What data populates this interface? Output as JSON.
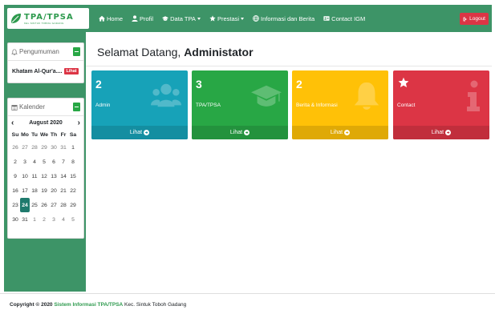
{
  "brand": {
    "name": "TPA/TPSA",
    "subtitle": "KEL.SINTUK TOBOH GADANG"
  },
  "nav": {
    "items": [
      {
        "label": "Home",
        "icon": "home-icon"
      },
      {
        "label": "Profil",
        "icon": "user-icon"
      },
      {
        "label": "Data TPA",
        "icon": "graduation-cap-icon",
        "dropdown": true
      },
      {
        "label": "Prestasi",
        "icon": "star-icon",
        "dropdown": true
      },
      {
        "label": "Informasi dan Berita",
        "icon": "globe-icon"
      },
      {
        "label": "Contact IGM",
        "icon": "address-card-icon"
      }
    ],
    "logout_label": "Logout"
  },
  "sidebar": {
    "announcement": {
      "title": "Pengumuman",
      "item_text": "Khatam Al-Qur'a....",
      "item_badge": "Lihat"
    },
    "calendar": {
      "title": "Kalender",
      "prev": "‹",
      "next": "›",
      "month_label": "August 2020",
      "weekdays": [
        "Su",
        "Mo",
        "Tu",
        "We",
        "Th",
        "Fr",
        "Sa"
      ],
      "weeks": [
        [
          "26",
          "27",
          "28",
          "29",
          "30",
          "31",
          "1"
        ],
        [
          "2",
          "3",
          "4",
          "5",
          "6",
          "7",
          "8"
        ],
        [
          "9",
          "10",
          "11",
          "12",
          "13",
          "14",
          "15"
        ],
        [
          "16",
          "17",
          "18",
          "19",
          "20",
          "21",
          "22"
        ],
        [
          "23",
          "24",
          "25",
          "26",
          "27",
          "28",
          "29"
        ],
        [
          "30",
          "31",
          "1",
          "2",
          "3",
          "4",
          "5"
        ]
      ],
      "today": "24"
    }
  },
  "main": {
    "greeting": "Selamat Datang,",
    "username": "Administator",
    "boxes": [
      {
        "count": "2",
        "label": "Admin",
        "footer": "Lihat",
        "icon": "users-icon",
        "color": "#17a2b8",
        "footer_color": "#148ea1"
      },
      {
        "count": "3",
        "label": "TPA/TPSA",
        "footer": "Lihat",
        "icon": "graduation-cap-icon",
        "color": "#28a745",
        "footer_color": "#23923d"
      },
      {
        "count": "2",
        "label": "Berita & Informasi",
        "footer": "Lihat",
        "icon": "bell-icon",
        "color": "#ffc107",
        "footer_color": "#dfa906"
      },
      {
        "count": "",
        "label": "Contact",
        "footer": "Lihat",
        "icon": "info-icon",
        "top_icon": "star-icon",
        "color": "#dc3545",
        "footer_color": "#c12e3c"
      }
    ]
  },
  "footer": {
    "copyright": "Copyright © 2020",
    "system": "Sistem Informasi TPA/TPSA",
    "location": "Kec. Sintuk Toboh Gadang"
  },
  "colors": {
    "navbar": "#3d9467",
    "sidebar": "#3d9467",
    "logout": "#dc3545"
  }
}
